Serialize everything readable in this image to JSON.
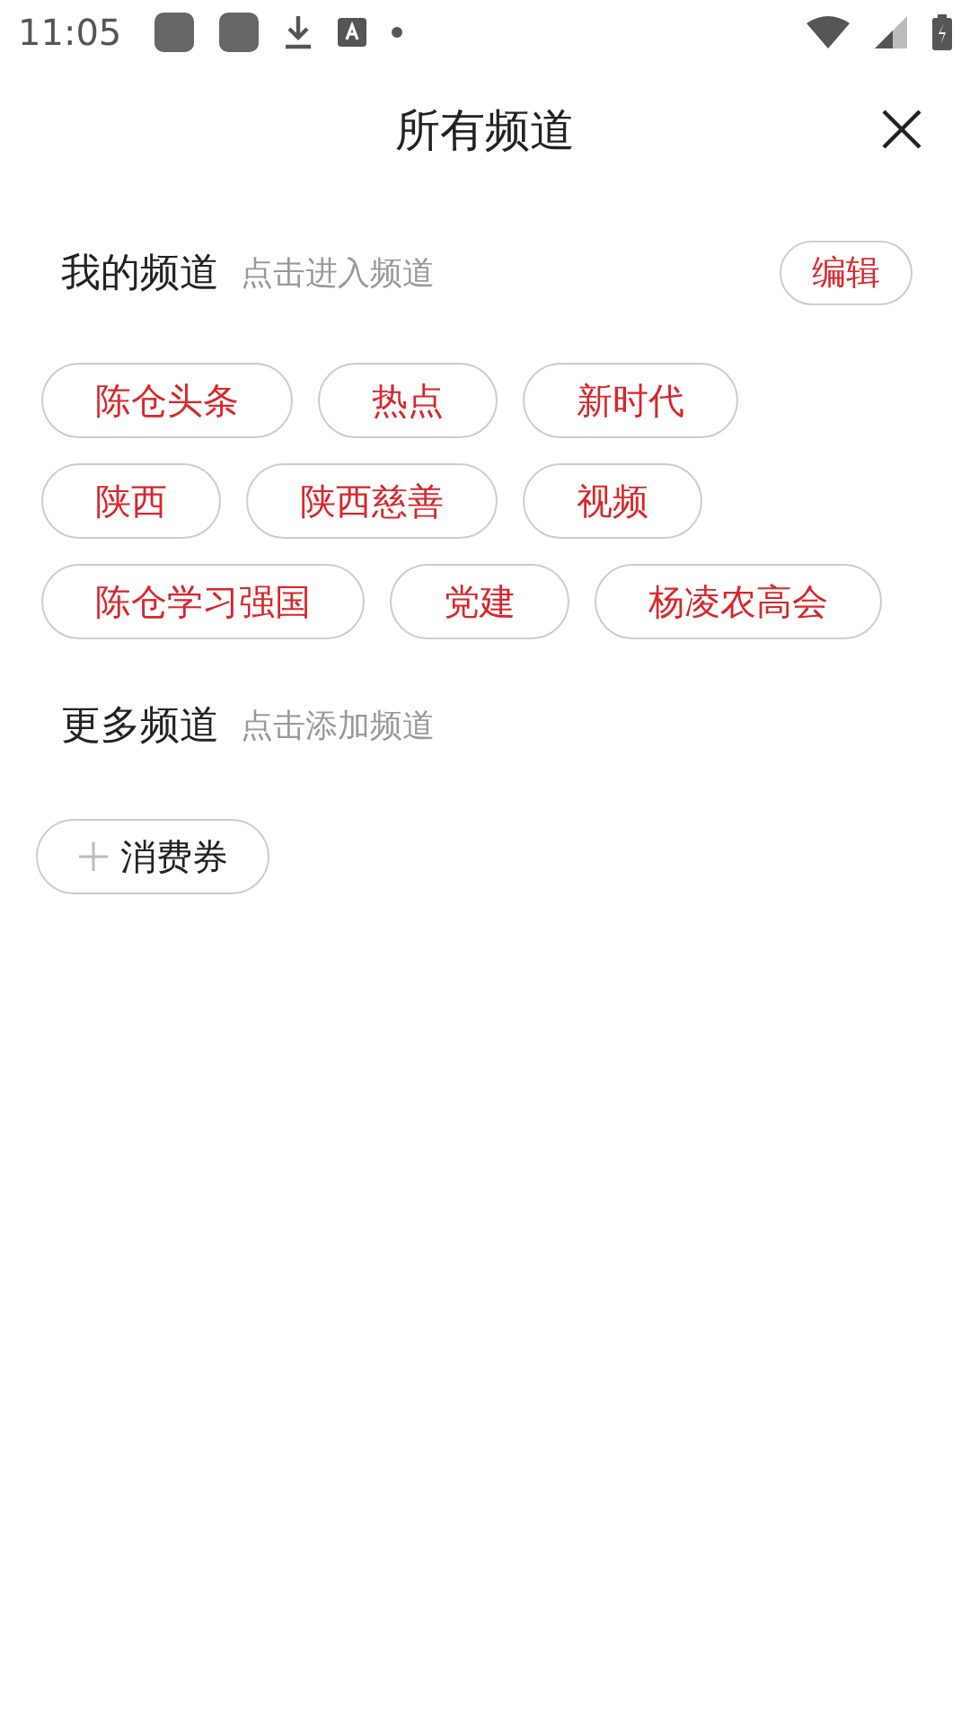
{
  "status_bar": {
    "time": "11:05"
  },
  "header": {
    "title": "所有频道"
  },
  "my_channels": {
    "title": "我的频道",
    "hint": "点击进入频道",
    "edit_button": "编辑",
    "items": [
      "陈仓头条",
      "热点",
      "新时代",
      "陕西",
      "陕西慈善",
      "视频",
      "陈仓学习强国",
      "党建",
      "杨凌农高会"
    ]
  },
  "more_channels": {
    "title": "更多频道",
    "hint": "点击添加频道",
    "items": [
      "消费券"
    ]
  }
}
